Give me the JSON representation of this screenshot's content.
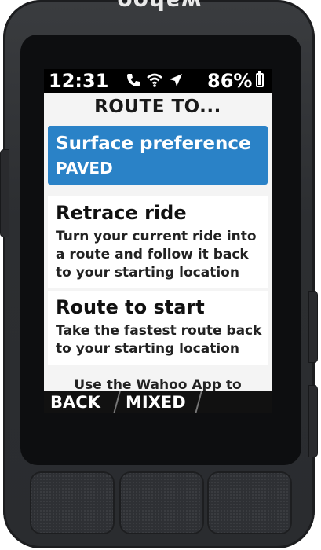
{
  "device": {
    "brand": "wahoo"
  },
  "status": {
    "time": "12:31",
    "battery": "86%",
    "battery_level": 0.86,
    "icons": [
      "phone-icon",
      "wifi-icon",
      "location-arrow-icon",
      "battery-icon"
    ]
  },
  "screen": {
    "title": "ROUTE TO...",
    "selected": {
      "label": "Surface preference",
      "value": "PAVED"
    },
    "options": [
      {
        "title": "Retrace ride",
        "desc": "Turn your current ride into a route and follow it back to your starting location"
      },
      {
        "title": "Route to start",
        "desc": "Take the fastest route back to your starting location"
      }
    ],
    "hint": "Use the Wahoo App to"
  },
  "softkeys": {
    "left": "BACK",
    "center": "MIXED"
  },
  "colors": {
    "accent": "#2a82c7",
    "screen_bg": "#f4f4f4",
    "device": "#2c2e31"
  }
}
